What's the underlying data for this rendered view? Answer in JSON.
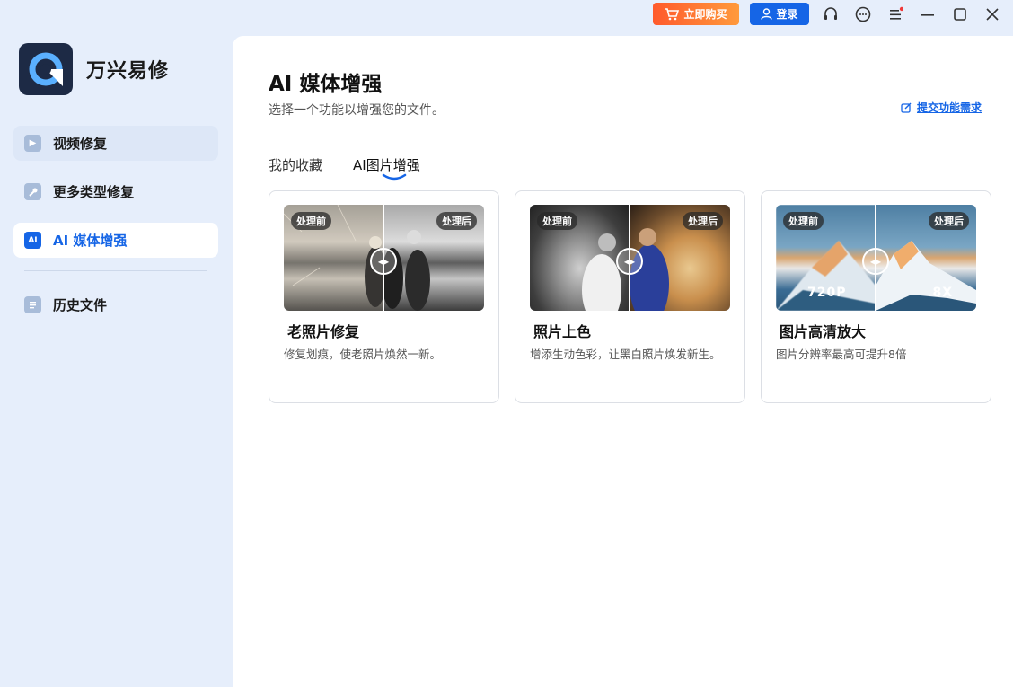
{
  "app": {
    "name": "万兴易修"
  },
  "titlebar": {
    "buy_label": "立即购买",
    "login_label": "登录"
  },
  "sidebar": {
    "items": [
      {
        "label": "视频修复"
      },
      {
        "label": "更多类型修复"
      },
      {
        "label": "AI 媒体增强",
        "icon_text": "AI"
      },
      {
        "label": "历史文件"
      }
    ]
  },
  "main": {
    "title": "AI 媒体增强",
    "subtitle": "选择一个功能以增强您的文件。",
    "feedback_link": "提交功能需求",
    "tabs": [
      {
        "label": "我的收藏"
      },
      {
        "label": "AI图片增强"
      }
    ],
    "cards": [
      {
        "title": "老照片修复",
        "description": "修复划痕，使老照片焕然一新。",
        "before_badge": "处理前",
        "after_badge": "处理后"
      },
      {
        "title": "照片上色",
        "description": "增添生动色彩，让黑白照片焕发新生。",
        "before_badge": "处理前",
        "after_badge": "处理后"
      },
      {
        "title": "图片高清放大",
        "description": "图片分辨率最高可提升8倍",
        "before_badge": "处理前",
        "after_badge": "处理后",
        "before_res": "720P",
        "after_res": "8X"
      }
    ]
  },
  "colors": {
    "accent": "#1565e6",
    "buy_gradient_start": "#ff5a2c",
    "buy_gradient_end": "#ff9a3c",
    "sidebar_bg": "#e6eefb"
  }
}
